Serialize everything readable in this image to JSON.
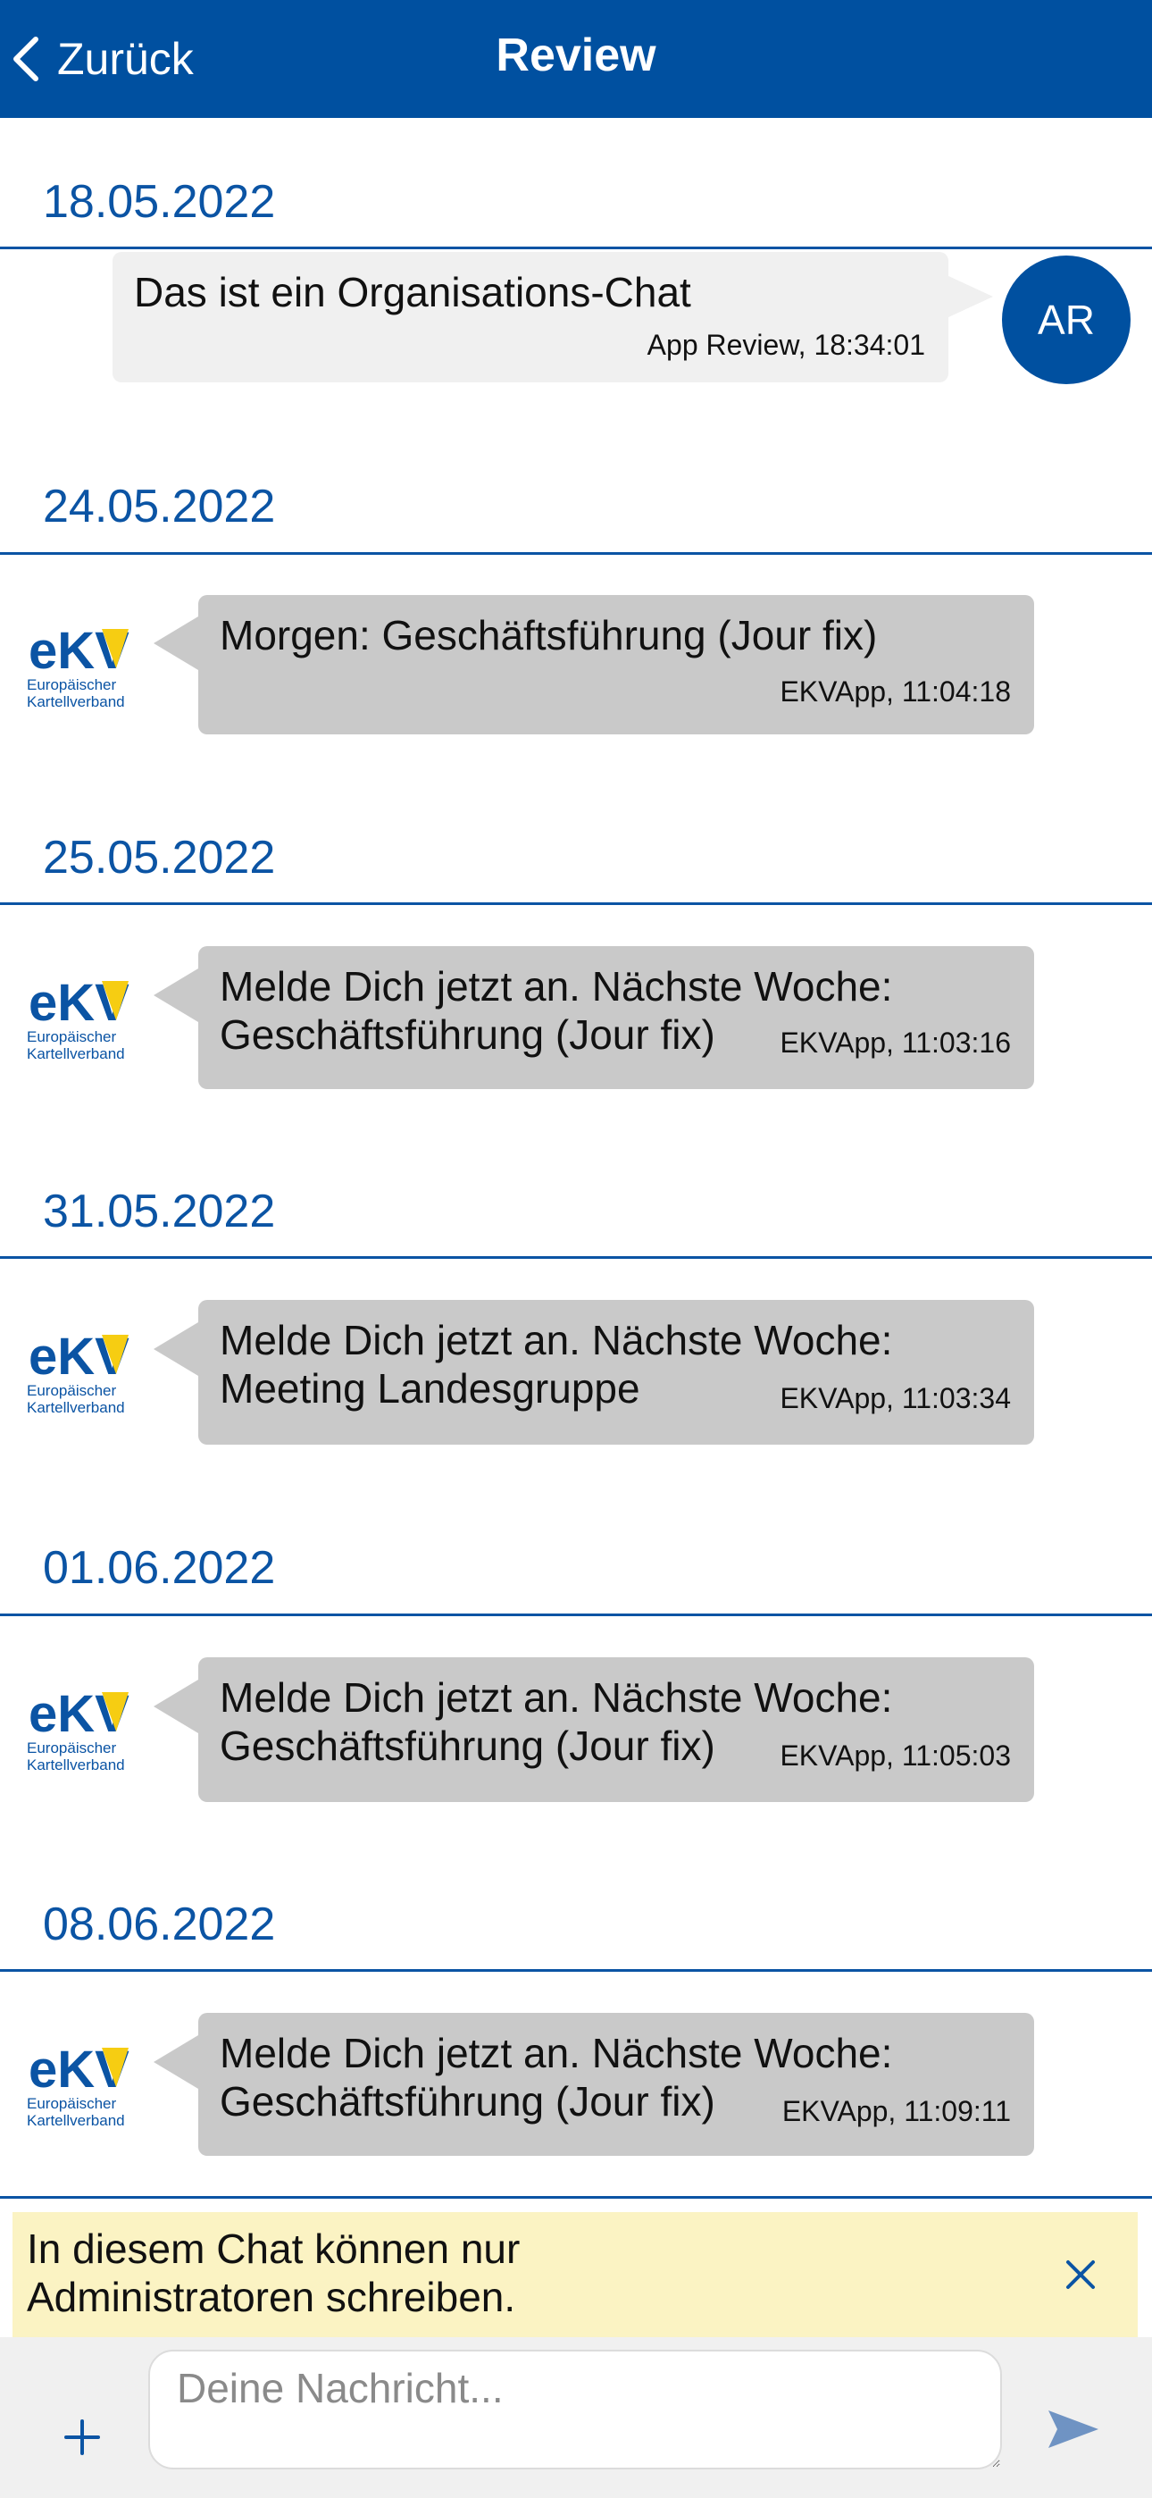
{
  "header": {
    "back_label": "Zurück",
    "title": "Review"
  },
  "messages": [
    {
      "date": "18.05.2022",
      "text": "Das ist ein Organisations-Chat",
      "meta": "App Review, 18:34:01",
      "avatar": "AR"
    },
    {
      "date": "24.05.2022",
      "text": "Morgen: Geschäftsführung (Jour fix)",
      "meta": "EKVApp, 11:04:18"
    },
    {
      "date": "25.05.2022",
      "line1": "Melde Dich jetzt an. Nächste Woche:",
      "line2": "Geschäftsführung (Jour fix)",
      "meta": "EKVApp, 11:03:16"
    },
    {
      "date": "31.05.2022",
      "line1": "Melde Dich jetzt an. Nächste Woche:",
      "line2": "Meeting Landesgruppe",
      "meta": "EKVApp, 11:03:34"
    },
    {
      "date": "01.06.2022",
      "line1": "Melde Dich jetzt an. Nächste Woche:",
      "line2": "Geschäftsführung (Jour fix)",
      "meta": "EKVApp, 11:05:03"
    },
    {
      "date": "08.06.2022",
      "line1": "Melde Dich jetzt an. Nächste Woche:",
      "line2": "Geschäftsführung (Jour fix)",
      "meta": "EKVApp, 11:09:11"
    }
  ],
  "logo": {
    "wordmark": "eKV",
    "line1": "Europäischer",
    "line2": "Kartellverband"
  },
  "notice": {
    "line1": "In diesem Chat können nur",
    "line2": "Administratoren schreiben."
  },
  "composer": {
    "placeholder": "Deine Nachricht...",
    "value": ""
  },
  "colors": {
    "brand": "#0050a0",
    "notice": "#fbf3c3",
    "bubble_mine": "#f0f0f0",
    "bubble_theirs": "#c9c9c9",
    "logo_yellow": "#f6cd12"
  },
  "icons": [
    "chevron-left-icon",
    "close-icon",
    "plus-icon",
    "send-icon"
  ]
}
